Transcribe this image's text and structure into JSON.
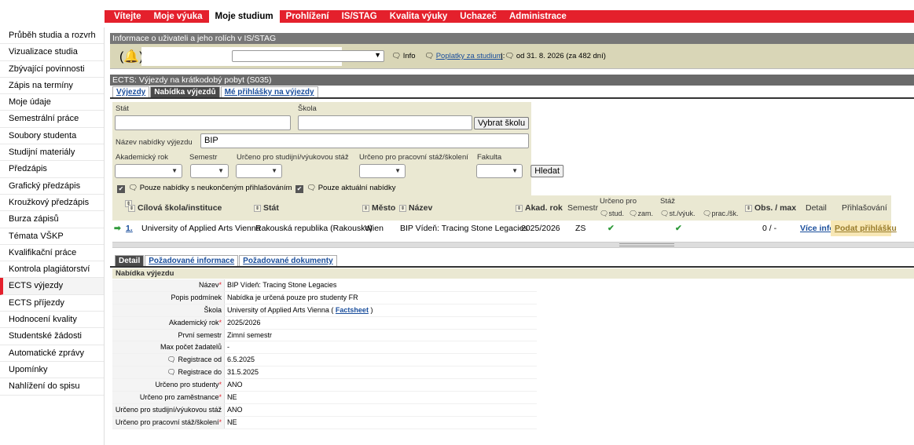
{
  "nav": {
    "items": [
      "Vítejte",
      "Moje výuka",
      "Moje studium",
      "Prohlížení",
      "IS/STAG",
      "Kvalita výuky",
      "Uchazeč",
      "Administrace"
    ],
    "active_index": 2
  },
  "sidebar": {
    "items": [
      "Průběh studia a rozvrh",
      "Vizualizace studia",
      "Zbývající povinnosti",
      "Zápis na termíny",
      "Moje údaje",
      "Semestrální práce",
      "Soubory studenta",
      "Studijní materiály",
      "Předzápis",
      "Grafický předzápis",
      "Kroužkový předzápis",
      "Burza zápisů",
      "Témata VŠKP",
      "Kvalifikační práce",
      "Kontrola plagiátorství",
      "ECTS výjezdy",
      "ECTS příjezdy",
      "Hodnocení kvality",
      "Studentské žádosti",
      "Automatické zprávy",
      "Upomínky",
      "Nahlížení do spisu"
    ],
    "active_index": 15
  },
  "userinfo": {
    "title": "Informace o uživateli a jeho rolích v IS/STAG",
    "info_label": "Info",
    "fees_label": "Poplatky za studium",
    "validity": "od 31. 8. 2026 (za 482 dní)"
  },
  "ects": {
    "title": "ECTS: Výjezdy na krátkodobý pobyt (S035)",
    "tabs": [
      "Výjezdy",
      "Nabídka výjezdů",
      "Mé přihlášky na výjezdy"
    ],
    "active_tab": 1
  },
  "filter": {
    "stat_label": "Stát",
    "skola_label": "Škola",
    "vybrat_skolu": "Vybrat školu",
    "nazev_label": "Název nabídky výjezdu",
    "nazev_value": "BIP",
    "akad_rok_label": "Akademický rok",
    "semestr_label": "Semestr",
    "urceno_stud_label": "Určeno pro studijní/výukovou stáž",
    "urceno_prac_label": "Určeno pro pracovní stáž/školení",
    "fakulta_label": "Fakulta",
    "hledat": "Hledat",
    "chk1": "Pouze nabídky s neukončeným přihlašováním",
    "chk2": "Pouze aktuální nabídky"
  },
  "table": {
    "headers": {
      "skola": "Cílová škola/instituce",
      "stat": "Stát",
      "mesto": "Město",
      "nazev": "Název",
      "akad_rok": "Akad. rok",
      "semestr": "Semestr",
      "urceno_pro": "Určeno pro",
      "stud": "stud.",
      "zam": "zam.",
      "staz": "Stáž",
      "st_vyuk": "st./výuk.",
      "prac_sk": "prac./šk.",
      "obs_max": "Obs. / max",
      "detail": "Detail",
      "prihlasovani": "Přihlašování"
    },
    "row": {
      "index": "1.",
      "skola": "University of Applied Arts Vienna",
      "stat": "Rakouská republika (Rakousko)",
      "mesto": "Wien",
      "nazev": "BIP Vídeň: Tracing Stone Legacies",
      "akad_rok": "2025/2026",
      "semestr": "ZS",
      "check": "✔",
      "obs_max": "0 / -",
      "detail_link": "Více info",
      "apply_link": "Podat přihlášku"
    }
  },
  "detail": {
    "tabs": [
      "Detail",
      "Požadované informace",
      "Požadované dokumenty"
    ],
    "active_tab": 0,
    "section_title": "Nabídka výjezdu",
    "rows": [
      {
        "key": "Název",
        "value": "BIP Vídeň: Tracing Stone Legacies",
        "req": "*"
      },
      {
        "key": "Popis podmínek",
        "value": "Nabídka je určená pouze pro studenty FR",
        "req": ""
      },
      {
        "key": "Škola",
        "value": "University of Applied Arts Vienna",
        "req": ""
      },
      {
        "key": "Akademický rok",
        "value": "2025/2026",
        "req": "*"
      },
      {
        "key": "První semestr",
        "value": "Zimní semestr",
        "req": ""
      },
      {
        "key": "Max počet žadatelů",
        "value": "-",
        "req": ""
      },
      {
        "key": "Registrace od",
        "value": "6.5.2025",
        "req": ""
      },
      {
        "key": "Registrace do",
        "value": "31.5.2025",
        "req": ""
      },
      {
        "key": "Určeno pro studenty",
        "value": "ANO",
        "req": "*"
      },
      {
        "key": "Určeno pro zaměstnance",
        "value": "NE",
        "req": "*"
      },
      {
        "key": "Určeno pro studijní/výukovou stáž",
        "value": "ANO",
        "req": ""
      },
      {
        "key": "Určeno pro pracovní stáž/školení",
        "value": "NE",
        "req": "*"
      }
    ],
    "factsheet": "Factsheet"
  }
}
